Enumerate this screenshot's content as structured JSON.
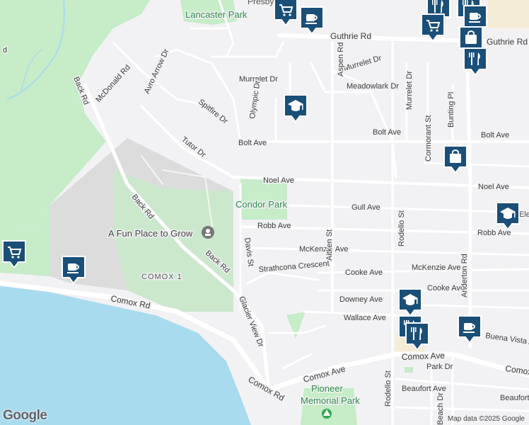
{
  "map": {
    "roads": {
      "guthrie_rd": "Guthrie Rd",
      "guthrie_rd_east": "Guthrie Rd",
      "murrelet_dr_west": "Murrelet Dr",
      "murrelet_dr_east": "Murrelet Dr",
      "meadowlark_dr": "Meadowlark Dr",
      "mcdonald_rd": "McDonald Rd",
      "avro_arrow_dr": "Avro Arrow Dr",
      "olympic_dr": "Olympic Dr",
      "spitfire_dr": "Spitfire Dr",
      "tutor_dr": "Tutor Dr",
      "bolt_ave_west": "Bolt Ave",
      "bolt_ave_mid": "Bolt Ave",
      "bolt_ave_east": "Bolt Ave",
      "noel_ave_west": "Noel Ave",
      "noel_ave_east": "Noel Ave",
      "gull_ave": "Gull Ave",
      "robb_ave_west": "Robb Ave",
      "robb_ave_east": "Robb Ave",
      "mckenzie_ave_west": "McKenzie Ave",
      "mckenzie_ave_east": "McKenzie Ave",
      "cooke_ave_west": "Cooke Ave",
      "cooke_ave_east": "Cooke Ave",
      "downey_ave": "Downey Ave",
      "wallace_ave": "Wallace Ave",
      "buena_vista_ave": "Buena Vista Av",
      "strathcona_crescent": "Strathcona Crescent",
      "davis_st": "Davis St",
      "glacier_view_dr": "Glacier View Dr",
      "aitken_st": "Aitken St",
      "aspen_rd": "Aspen Rd",
      "rodello_st_north": "Rodello St",
      "rodello_st_south": "Rodello St",
      "murrelet_dr_ns": "Murrelet Dr",
      "cormorant_st": "Cormorant St",
      "bunting_pl": "Bunting Pl",
      "anderton_rd": "Anderton Rd",
      "back_rd_north": "Back Rd",
      "back_rd_mid": "Back Rd",
      "back_rd_south": "Back Rd",
      "comox_rd": "Comox Rd",
      "comox_rd_south": "Comox Rd",
      "comox_ave": "Comox Ave",
      "comox_ave_mid": "Comox Ave",
      "comox_ave_east": "Comox Ave",
      "park_dr": "Park Dr",
      "beaufort_ave": "Beaufort Ave",
      "beaufort_ave_east": "Beaufort",
      "beach_dr": "Beach Dr",
      "west_rd_fragment": "d"
    },
    "places": {
      "lancaster_park": "Lancaster Park",
      "condor_park": "Condor Park",
      "pioneer_park_line1": "Pioneer",
      "pioneer_park_line2": "Memorial Park",
      "fun_place": "A Fun Place to Grow",
      "comox1": "COMOX 1",
      "presbyterian": "Presbyteri",
      "school_east": "Ele"
    },
    "pois": [
      {
        "kind": "cart-icon"
      },
      {
        "kind": "cafe-icon"
      },
      {
        "kind": "restaurant-icon"
      },
      {
        "kind": "restaurant-icon"
      },
      {
        "kind": "cart-icon"
      },
      {
        "kind": "cafe-icon"
      },
      {
        "kind": "shopping-bag-icon"
      },
      {
        "kind": "restaurant-icon"
      },
      {
        "kind": "school-icon"
      },
      {
        "kind": "shopping-bag-icon"
      },
      {
        "kind": "school-icon"
      },
      {
        "kind": "cart-icon"
      },
      {
        "kind": "cafe-icon"
      },
      {
        "kind": "school-icon"
      },
      {
        "kind": "restaurant-icon"
      },
      {
        "kind": "cafe-icon"
      },
      {
        "kind": "restaurant-icon"
      }
    ],
    "attribution": {
      "logo": "Google",
      "copyright": "Map data ©2025 Google"
    },
    "colors": {
      "water": "#a9dbef",
      "park": "#c6ecc8",
      "military": "#dcdcdc",
      "road": "#ffffff",
      "land": "#f2f2f4",
      "poi_marker": "#1a4f78"
    }
  }
}
